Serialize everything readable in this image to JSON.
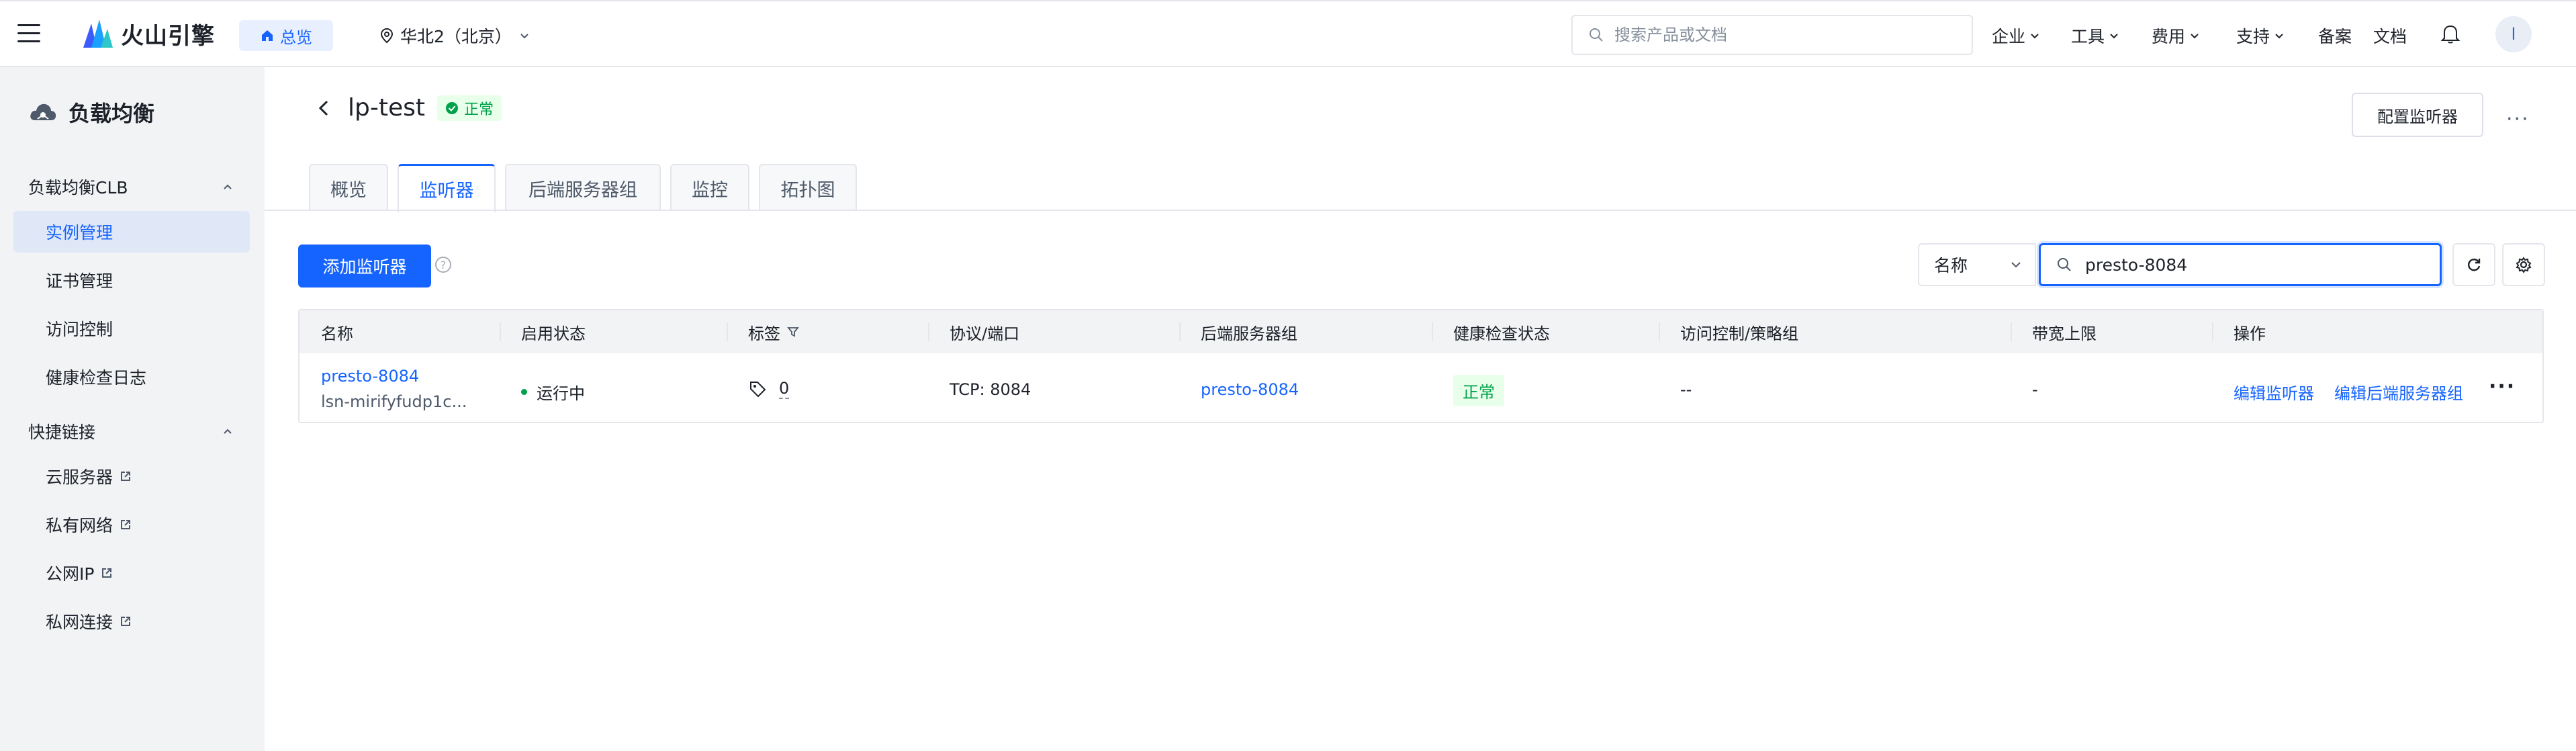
{
  "topbar": {
    "brand": "火山引擎",
    "overview": "总览",
    "region": "华北2（北京）",
    "search_placeholder": "搜索产品或文档",
    "nav": [
      "企业",
      "工具",
      "费用",
      "支持",
      "备案",
      "文档"
    ],
    "avatar": "l"
  },
  "sidebar": {
    "title": "负载均衡",
    "group1": "负载均衡CLB",
    "group1_items": [
      "实例管理",
      "证书管理",
      "访问控制",
      "健康检查日志"
    ],
    "group2": "快捷链接",
    "group2_items": [
      "云服务器",
      "私有网络",
      "公网IP",
      "私网连接"
    ]
  },
  "page": {
    "title": "lp-test",
    "status": "正常",
    "config_button": "配置监听器",
    "tabs": [
      "概览",
      "监听器",
      "后端服务器组",
      "监控",
      "拓扑图"
    ],
    "active_tab": "监听器"
  },
  "toolbar": {
    "add_button": "添加监听器",
    "help": "?",
    "filter_field": "名称",
    "filter_value": "presto-8084"
  },
  "table": {
    "headers": [
      "名称",
      "启用状态",
      "标签",
      "协议/端口",
      "后端服务器组",
      "健康检查状态",
      "访问控制/策略组",
      "带宽上限",
      "操作"
    ],
    "rows": [
      {
        "name": "presto-8084",
        "id": "lsn-mirifyfudp1c...",
        "enabled": "运行中",
        "tags": "0",
        "protocol_port": "TCP: 8084",
        "server_group": "presto-8084",
        "health": "正常",
        "acl": "--",
        "bandwidth": "-",
        "action1": "编辑监听器",
        "action2": "编辑后端服务器组"
      }
    ]
  },
  "colors": {
    "primary": "#1664ff",
    "success": "#00a14a",
    "success_bg": "#e8ffea",
    "sidebar_bg": "#f2f3f5"
  }
}
